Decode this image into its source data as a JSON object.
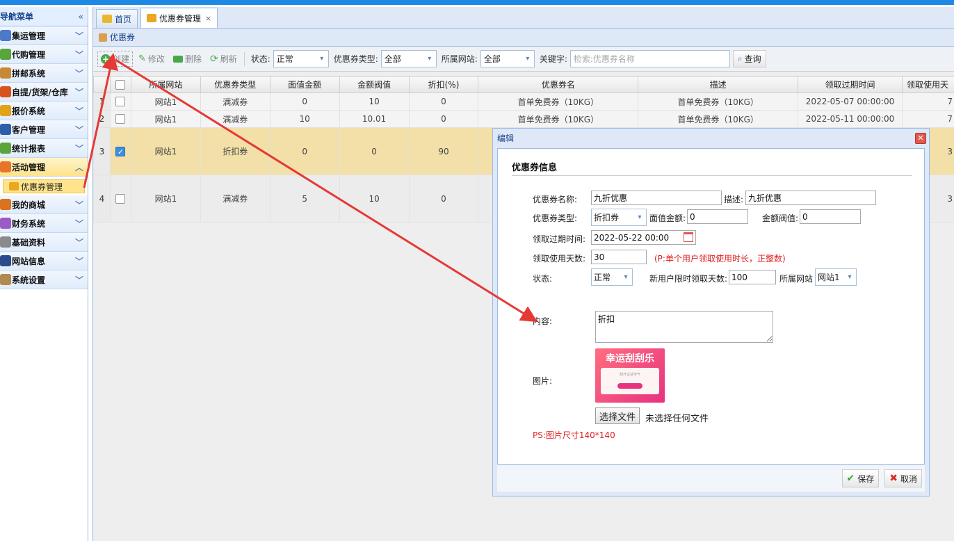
{
  "sidebar": {
    "title": "导航菜单",
    "items": [
      {
        "label": "集运管理",
        "icon": "monitor-icon",
        "color": "#4a7ac9"
      },
      {
        "label": "代购管理",
        "icon": "globe-icon",
        "color": "#5aa43c"
      },
      {
        "label": "拼邮系统",
        "icon": "box-icon",
        "color": "#c78a34"
      },
      {
        "label": "自提/货架/仓库",
        "icon": "ball-icon",
        "color": "#d9531e"
      },
      {
        "label": "报价系统",
        "icon": "coins-icon",
        "color": "#e0a31a"
      },
      {
        "label": "客户管理",
        "icon": "user-icon",
        "color": "#2d5fa8"
      },
      {
        "label": "统计报表",
        "icon": "globe-icon",
        "color": "#5aa43c"
      },
      {
        "label": "活动管理",
        "icon": "rainbow-icon",
        "color": "#e8742a"
      },
      {
        "label": "我的商城",
        "icon": "basketball-icon",
        "color": "#d9731e"
      },
      {
        "label": "财务系统",
        "icon": "colorwheel-icon",
        "color": "#9c5ac7"
      },
      {
        "label": "基础资料",
        "icon": "stack-icon",
        "color": "#8a8a8a"
      },
      {
        "label": "网站信息",
        "icon": "font-icon",
        "color": "#2a4a8a"
      },
      {
        "label": "系统设置",
        "icon": "wrench-icon",
        "color": "#b08a50"
      }
    ],
    "sub_item": "优惠券管理"
  },
  "tabs": [
    {
      "label": "首页"
    },
    {
      "label": "优惠券管理"
    }
  ],
  "panel_title": "优惠券",
  "toolbar": {
    "create": "创建",
    "edit": "修改",
    "delete": "删除",
    "refresh": "刷新",
    "status_label": "状态:",
    "status_value": "正常",
    "type_label": "优惠券类型:",
    "type_value": "全部",
    "site_label": "所属网站:",
    "site_value": "全部",
    "keyword_label": "关键字:",
    "keyword_placeholder": "检索:优惠券名称",
    "query": "查询"
  },
  "table": {
    "columns": [
      "所属网站",
      "优惠券类型",
      "面值金额",
      "金额阀值",
      "折扣(%)",
      "优惠券名",
      "描述",
      "领取过期时间",
      "领取使用天"
    ],
    "rows": [
      {
        "no": "1",
        "checked": false,
        "cells": [
          "网站1",
          "满减券",
          "0",
          "10",
          "0",
          "首单免费券（10KG）",
          "首单免费券（10KG）",
          "2022-05-07 00:00:00",
          "7"
        ]
      },
      {
        "no": "2",
        "checked": false,
        "cells": [
          "网站1",
          "满减券",
          "10",
          "10.01",
          "0",
          "首单免费券（10KG）",
          "首单免费券（10KG）",
          "2022-05-11 00:00:00",
          "7"
        ]
      },
      {
        "no": "3",
        "checked": true,
        "cells": [
          "网站1",
          "折扣券",
          "0",
          "0",
          "90",
          "",
          "",
          "",
          "3"
        ]
      },
      {
        "no": "4",
        "checked": false,
        "cells": [
          "网站1",
          "满减券",
          "5",
          "10",
          "0",
          "",
          "",
          "",
          "3"
        ]
      }
    ]
  },
  "dialog": {
    "title": "编辑",
    "section": "优惠券信息",
    "name_label": "优惠券名称:",
    "name_value": "九折优惠",
    "desc_label": "描述:",
    "desc_value": "九折优惠",
    "type_label": "优惠券类型:",
    "type_value": "折扣券",
    "face_label": "面值金额:",
    "face_value": "0",
    "threshold_label": "金额阀值:",
    "threshold_value": "0",
    "expire_label": "领取过期时间:",
    "expire_value": "2022-05-22 00:00",
    "days_label": "领取使用天数:",
    "days_value": "30",
    "days_hint": "(P:单个用户领取使用时长，正整数)",
    "status_label": "状态:",
    "status_value": "正常",
    "newuser_label": "新用户限时领取天数:",
    "newuser_value": "100",
    "site_label": "所属网站",
    "site_value": "网站1",
    "content_label": "内容:",
    "content_value": "折扣",
    "image_label": "图片:",
    "image_title": "幸运刮刮乐",
    "image_small": "刮开试试手气",
    "file_button": "选择文件",
    "file_status": "未选择任何文件",
    "image_hint": "PS:图片尺寸140*140",
    "save": "保存",
    "cancel": "取消"
  },
  "colors": {
    "accent": "#1e88e5",
    "selected_row": "#f2e0a8",
    "annotation_arrow": "#e53935"
  }
}
